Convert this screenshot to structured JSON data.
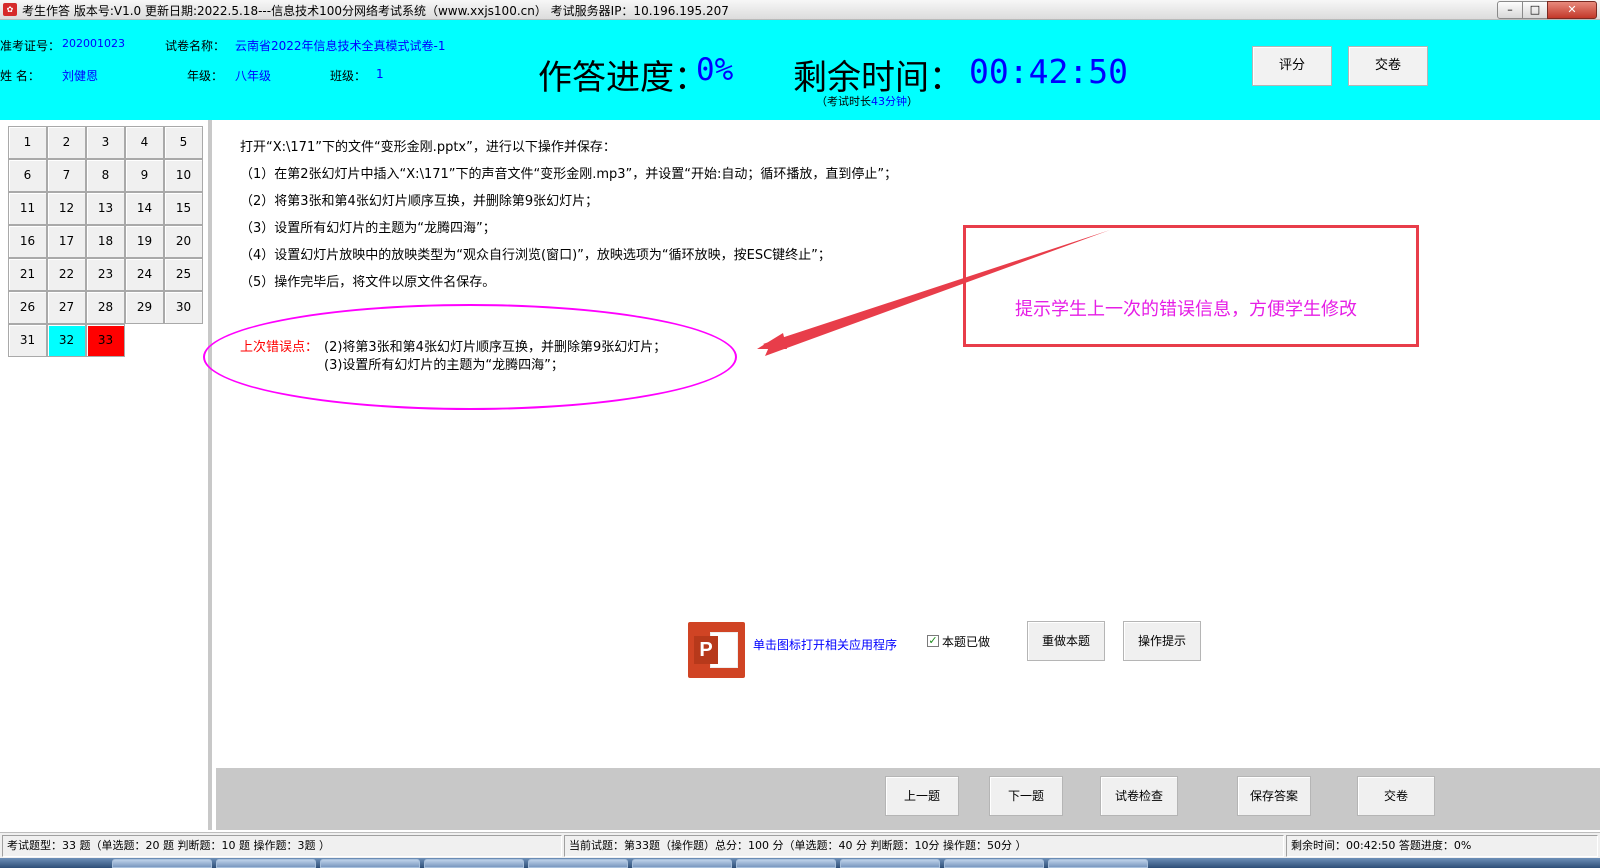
{
  "window": {
    "title": "考生作答 版本号:V1.0 更新日期:2022.5.18---信息技术100分网络考试系统（www.xxjs100.cn）   考试服务器IP：10.196.195.207",
    "minimize": "–",
    "maximize": "□",
    "close": "✕"
  },
  "header": {
    "exam_id_label": "准考证号：",
    "exam_id": "202001023",
    "paper_label": "试卷名称：",
    "paper_name": "云南省2022年信息技术全真模式试卷-1",
    "name_label": "姓    名：",
    "name": "刘健恩",
    "grade_label": "年级：",
    "grade": "八年级",
    "class_label": "班级：",
    "class": "1",
    "progress_label": "作答进度：",
    "progress_value": "0%",
    "time_label": "剩余时间：",
    "time_value": "00:42:50",
    "duration_prefix": "（考试时长",
    "duration_value": "43分钟",
    "duration_suffix": "）",
    "score_button": "评分",
    "submit_button": "交卷"
  },
  "questions": {
    "items": [
      "1",
      "2",
      "3",
      "4",
      "5",
      "6",
      "7",
      "8",
      "9",
      "10",
      "11",
      "12",
      "13",
      "14",
      "15",
      "16",
      "17",
      "18",
      "19",
      "20",
      "21",
      "22",
      "23",
      "24",
      "25",
      "26",
      "27",
      "28",
      "29",
      "30",
      "31",
      "32",
      "33"
    ],
    "current": "32",
    "error": "33",
    "current_color": "#00ffff",
    "error_color": "#ff0000"
  },
  "task": {
    "lines": [
      "打开“X:\\171”下的文件“变形金刚.pptx”，进行以下操作并保存：",
      "（1）在第2张幻灯片中插入“X:\\171”下的声音文件“变形金刚.mp3”，并设置“开始:自动；循环播放，直到停止”；",
      "（2）将第3张和第4张幻灯片顺序互换，并删除第9张幻灯片；",
      "（3）设置所有幻灯片的主题为“龙腾四海”；",
      "（4）设置幻灯片放映中的放映类型为“观众自行浏览(窗口)”，放映选项为“循环放映，按ESC键终止”；",
      "（5）操作完毕后，将文件以原文件名保存。"
    ],
    "last_error_label": "上次错误点：",
    "last_error_lines": [
      "(2)将第3张和第4张幻灯片顺序互换，并删除第9张幻灯片；",
      "(3)设置所有幻灯片的主题为“龙腾四海”；"
    ],
    "annotation": "提示学生上一次的错误信息，方便学生修改",
    "annotation_color": "#e61ee6"
  },
  "controls": {
    "ppt_icon_letter": "P",
    "open_app_link": "单击图标打开相关应用程序",
    "done_check": "✓",
    "done_label": "本题已做",
    "redo_button": "重做本题",
    "hint_button": "操作提示"
  },
  "nav": {
    "prev": "上一题",
    "next": "下一题",
    "check": "试卷检查",
    "save": "保存答案",
    "submit": "交卷"
  },
  "status": {
    "types": "考试题型：33 题（单选题：20 题  判断题：10 题  操作题：3题 ）",
    "current": "当前试题：第33题（操作题）总分：100 分（单选题：40 分  判断题：10分  操作题：50分 ）",
    "remaining": "剩余时间：00:42:50  答题进度：0%"
  }
}
